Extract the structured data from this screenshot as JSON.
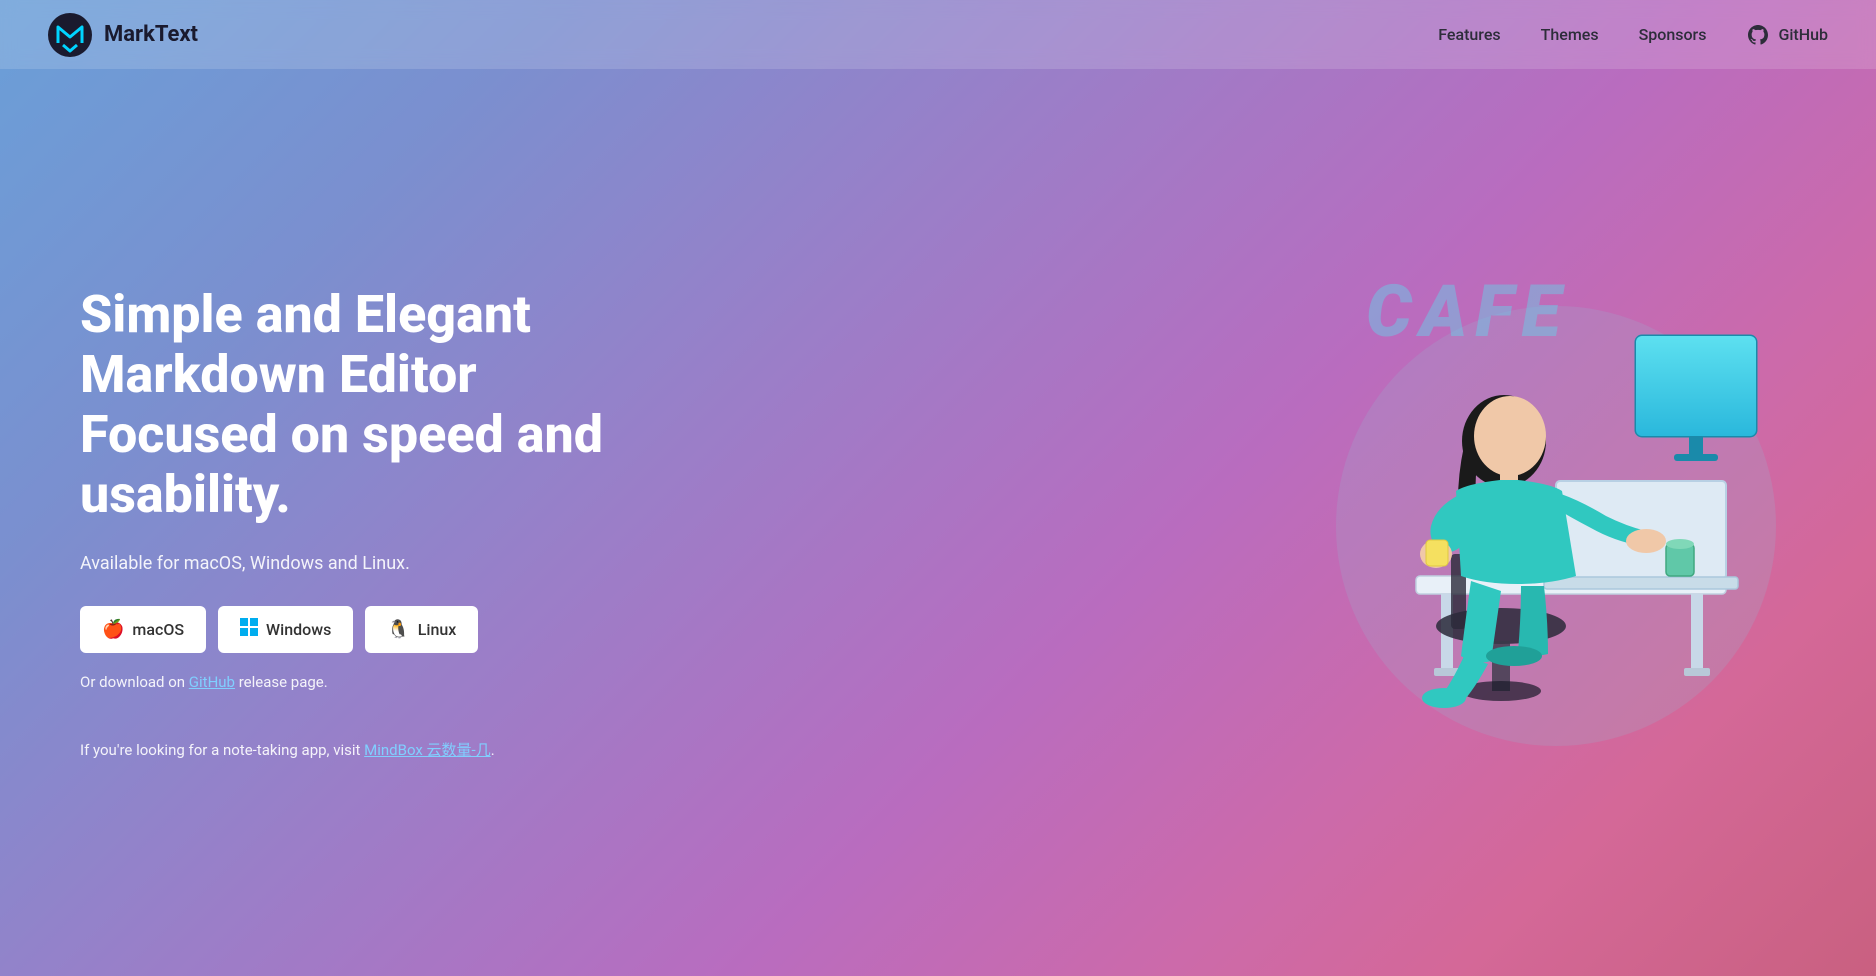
{
  "nav": {
    "brand": "MarkText",
    "links": [
      {
        "id": "features",
        "label": "Features"
      },
      {
        "id": "themes",
        "label": "Themes"
      },
      {
        "id": "sponsors",
        "label": "Sponsors"
      }
    ],
    "github_label": "GitHub"
  },
  "hero": {
    "title_line1": "Simple and Elegant Markdown Editor",
    "title_line2": "Focused on speed and usability.",
    "available_text": "Available for macOS, Windows and Linux.",
    "buttons": [
      {
        "id": "macos",
        "icon": "🍎",
        "label": "macOS"
      },
      {
        "id": "windows",
        "icon": "⊞",
        "label": "Windows"
      },
      {
        "id": "linux",
        "icon": "🐧",
        "label": "Linux"
      }
    ],
    "release_prefix": "Or download on ",
    "release_link": "GitHub",
    "release_suffix": " release page.",
    "notetaking_prefix": "If you're looking for a note-taking app, visit ",
    "notetaking_link": "MindBox 云数量-几",
    "notetaking_suffix": ".",
    "cafe_text": "CAFE"
  },
  "colors": {
    "accent_link": "#80cfff",
    "button_bg": "#ffffff",
    "button_text": "#333333",
    "nav_bg": "rgba(255,255,255,0.15)"
  }
}
